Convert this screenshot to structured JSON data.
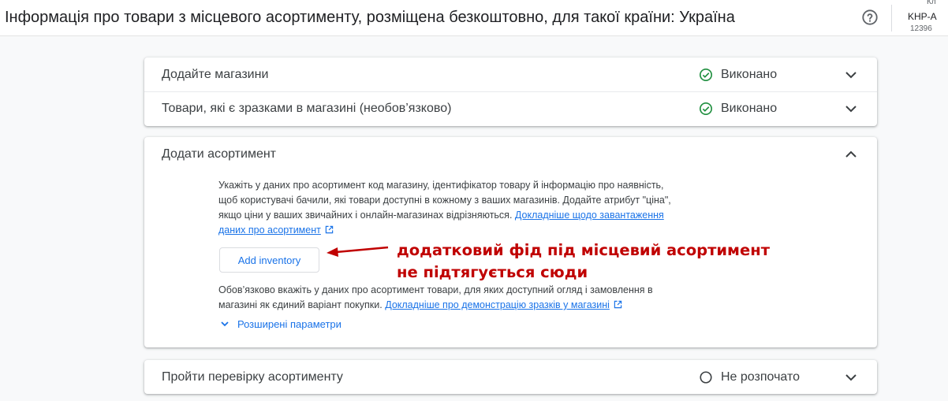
{
  "header": {
    "title": "Інформація про товари з місцевого асортименту, розміщена безкоштовно, для такої країни: Україна",
    "help_icon": "help-circle-icon",
    "account": {
      "top_label": "Кл",
      "name": "KHP-A",
      "id": "12396"
    }
  },
  "steps": [
    {
      "title": "Додайте магазини",
      "status": "Виконано",
      "status_icon": "check-circle-icon"
    },
    {
      "title": "Товари, які є зразками в магазині (необов’язково)",
      "status": "Виконано",
      "status_icon": "check-circle-icon"
    },
    {
      "title": "Додати асортимент",
      "expanded": true
    },
    {
      "title": "Пройти перевірку асортименту",
      "status": "Не розпочато",
      "status_icon": "empty-circle-icon"
    }
  ],
  "inventory_panel": {
    "intro_line1": "Укажіть у даних про асортимент код магазину, ідентифікатор товару й інформацію про наявність,",
    "intro_line2": "щоб користувачі бачили, які товари доступні в кожному з ваших магазинів. Додайте атрибут \"ціна\",",
    "intro_line3": "якщо ціни у ваших звичайних і онлайн-магазинах відрізняються.",
    "intro_link_part1": "Докладніше щодо завантаження",
    "intro_link_part2": "даних про асортимент",
    "button_label": "Add inventory",
    "note_line1": "Обов’язково вкажіть у даних про асортимент товари, для яких доступний огляд і замовлення в",
    "note_line2": "магазині як єдиний варіант покупки.",
    "note_link": "Докладніше про демонстрацію зразків у магазині",
    "advanced_label": "Розширені параметри"
  },
  "annotation": {
    "line1": "додатковий фід під місцевий асортимент",
    "line2": "не підтягується сюди",
    "color": "#c00000"
  },
  "colors": {
    "accent": "#1a73e8",
    "success": "#1e8e3e",
    "annotation": "#c00000"
  }
}
